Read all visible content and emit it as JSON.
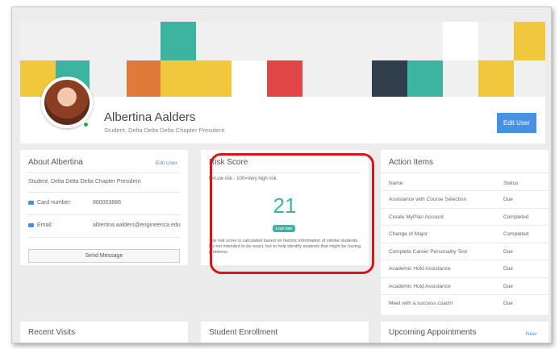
{
  "profile": {
    "name": "Albertina Aalders",
    "subtitle": "Student, Delta Delta Delta Chapter President",
    "edit_button": "Edit User"
  },
  "about": {
    "title": "About Albertina",
    "edit_link": "Edit User",
    "description": "Student, Delta Delta Delta Chapter President",
    "card_label": "Card number:",
    "card_value": "880003886",
    "email_label": "Email:",
    "email_value": "albertina.aalders@engineerica.edu",
    "send_button": "Send Message"
  },
  "risk": {
    "title": "Risk Score",
    "scale": "0=Low risk - 100=Very high risk",
    "score": "21",
    "level": "Low risk",
    "note": "The risk score is calculated based on historic information of similar students. It's not intended to be exact, but to help identify students that might be having problems."
  },
  "actions": {
    "title": "Action Items",
    "col_name": "Name",
    "col_status": "Status",
    "rows": [
      {
        "name": "Assistance with Course Selection",
        "status": "Due"
      },
      {
        "name": "Create MyPlan Account",
        "status": "Completed"
      },
      {
        "name": "Change of Major",
        "status": "Completed"
      },
      {
        "name": "Complete Career Personality Test",
        "status": "Due"
      },
      {
        "name": "Academic Hold Assistance",
        "status": "Due"
      },
      {
        "name": "Academic Hold Assistance",
        "status": "Due"
      },
      {
        "name": "Meet with a success coach!",
        "status": "Due"
      }
    ]
  },
  "bottom": {
    "recent_visits": "Recent Visits",
    "enrollment": "Student Enrollment",
    "appointments": "Upcoming Appointments",
    "new_link": "New"
  },
  "colors": {
    "accent": "#4a90e2",
    "teal": "#3bb5a0",
    "highlight": "#d81616"
  }
}
